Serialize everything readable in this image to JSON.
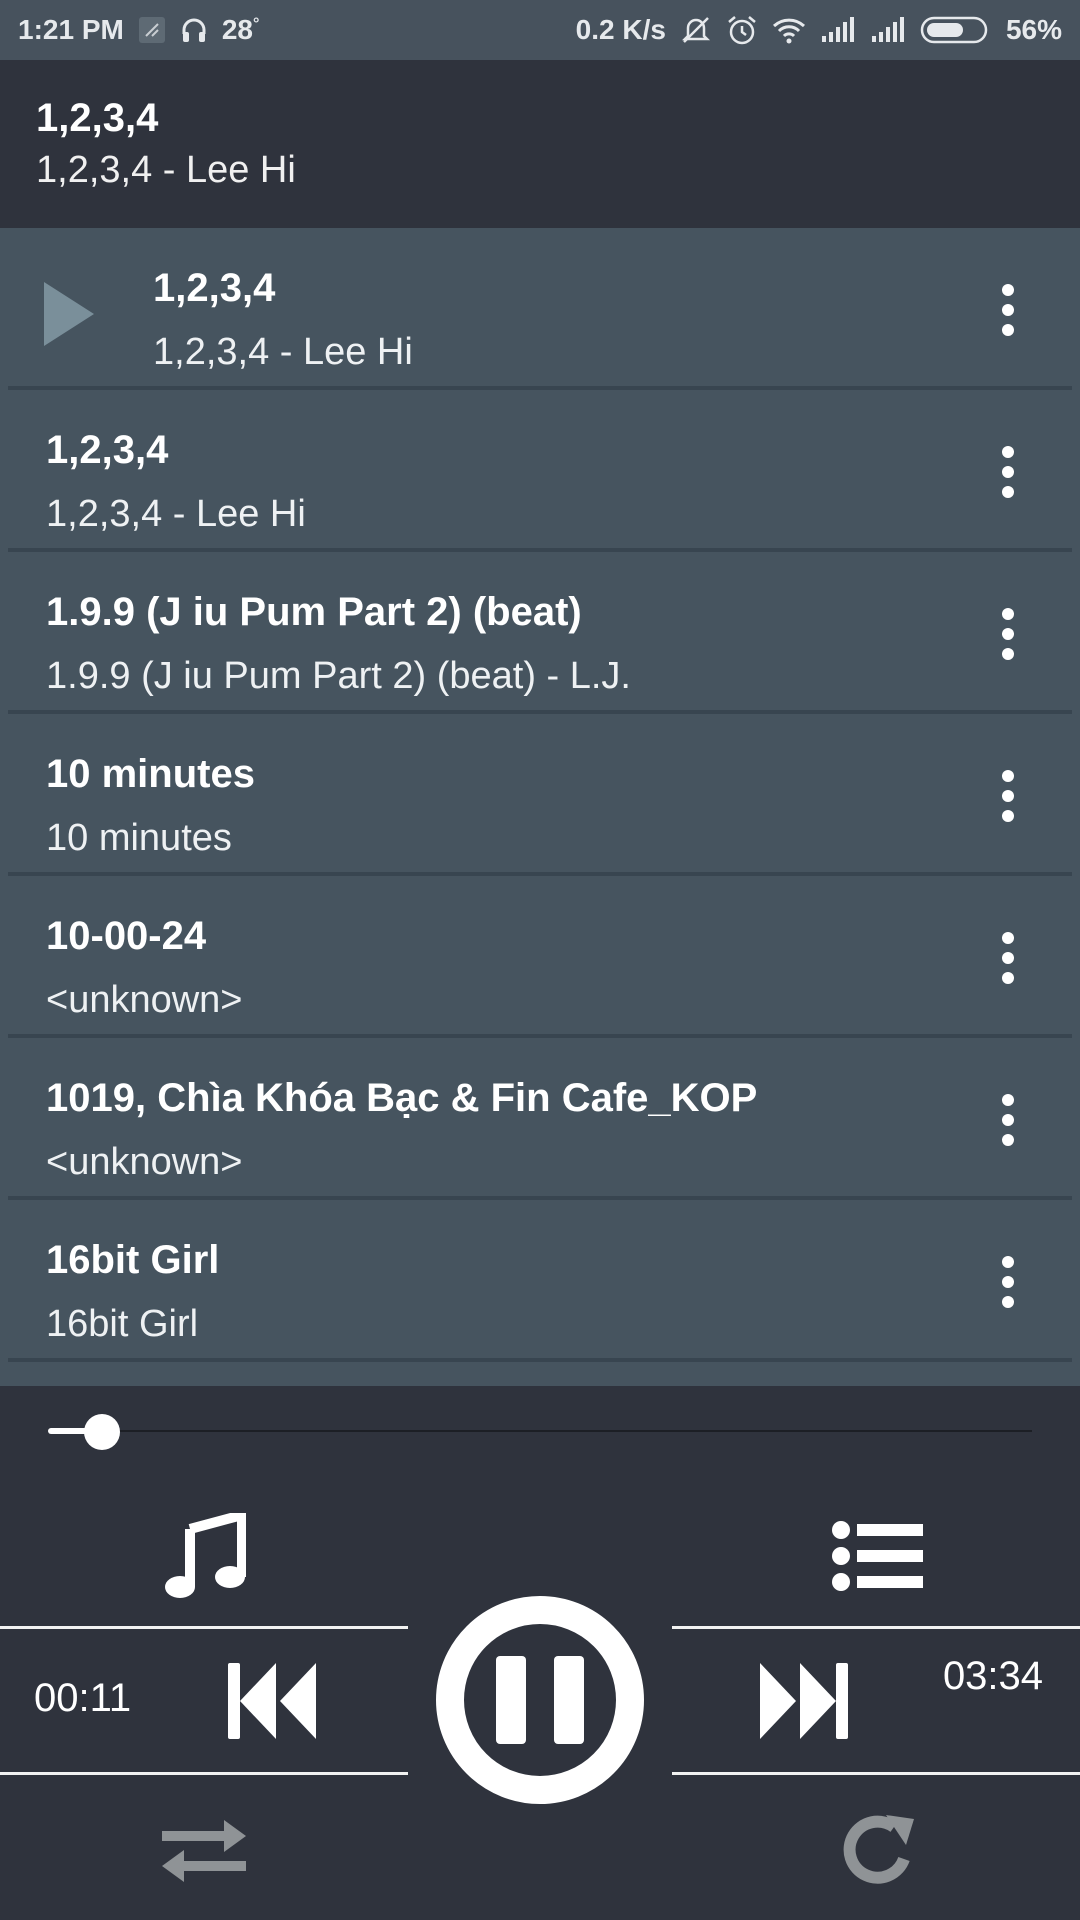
{
  "status_bar": {
    "time": "1:21 PM",
    "temperature": "28",
    "degree": "°",
    "net_speed": "0.2 K/s",
    "battery": "56%",
    "icons": [
      "app-icon",
      "headphones-icon",
      "mute-icon",
      "alarm-icon",
      "wifi-icon",
      "signal-icon",
      "signal-icon",
      "battery-icon"
    ]
  },
  "now_playing": {
    "title": "1,2,3,4",
    "subtitle": "1,2,3,4 - Lee Hi"
  },
  "tracks": [
    {
      "title": "1,2,3,4",
      "subtitle": "1,2,3,4 - Lee Hi",
      "playing": true
    },
    {
      "title": "1,2,3,4",
      "subtitle": "1,2,3,4 - Lee Hi",
      "playing": false
    },
    {
      "title": "1.9.9 (J iu Pum Part 2) (beat)",
      "subtitle": "1.9.9 (J iu Pum Part 2) (beat) - L.J.",
      "playing": false
    },
    {
      "title": "10 minutes",
      "subtitle": "10 minutes",
      "playing": false
    },
    {
      "title": "10-00-24",
      "subtitle": "<unknown>",
      "playing": false
    },
    {
      "title": "1019, Chìa Khóa Bạc & Fin Cafe_KOP",
      "subtitle": "<unknown>",
      "playing": false
    },
    {
      "title": "16bit Girl",
      "subtitle": "16bit Girl",
      "playing": false
    }
  ],
  "player": {
    "elapsed": "00:11",
    "duration": "03:34",
    "progress_fraction": 0.055
  },
  "colors": {
    "status_bar": "#47525d",
    "header": "#2f333d",
    "list_bg": "#46545f",
    "accent": "#ffffff"
  }
}
